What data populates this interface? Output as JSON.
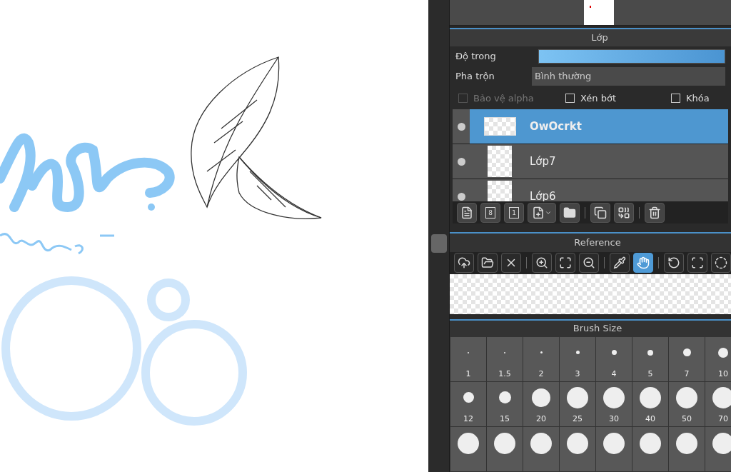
{
  "layers_panel": {
    "title": "Lớp",
    "opacity": {
      "label": "Độ trong",
      "level": 1
    },
    "blend": {
      "label": "Pha trộn",
      "value": "Bình thường"
    },
    "options": [
      {
        "label": "Bảo vệ alpha",
        "checked": false,
        "disabled": true
      },
      {
        "label": "Xén bớt",
        "checked": false,
        "disabled": false
      },
      {
        "label": "Khóa",
        "checked": false,
        "disabled": false
      }
    ],
    "layers": [
      {
        "name": "OwOcrkt",
        "selected": true,
        "visible": true
      },
      {
        "name": "Lớp7",
        "selected": false,
        "visible": true
      },
      {
        "name": "Lớp6",
        "selected": false,
        "visible": true
      }
    ],
    "tools": [
      {
        "kind": "new-page"
      },
      {
        "kind": "page-8",
        "label": "8"
      },
      {
        "kind": "page-1",
        "label": "1"
      },
      {
        "kind": "add-page"
      },
      {
        "kind": "folder"
      },
      {
        "kind": "sep"
      },
      {
        "kind": "duplicate"
      },
      {
        "kind": "merge"
      },
      {
        "kind": "sep"
      },
      {
        "kind": "trash"
      }
    ]
  },
  "reference_panel": {
    "title": "Reference",
    "tool_groups": [
      [
        {
          "kind": "upload",
          "selected": false
        },
        {
          "kind": "open-folder",
          "selected": false
        },
        {
          "kind": "close",
          "selected": false
        }
      ],
      [
        {
          "kind": "zoom-in",
          "selected": false
        },
        {
          "kind": "fit",
          "selected": false
        },
        {
          "kind": "zoom-out",
          "selected": false
        }
      ],
      [
        {
          "kind": "eyedropper",
          "selected": false
        },
        {
          "kind": "hand",
          "selected": true
        }
      ],
      [
        {
          "kind": "rotate",
          "selected": false
        },
        {
          "kind": "frame",
          "selected": false
        },
        {
          "kind": "reset",
          "selected": false
        }
      ]
    ]
  },
  "brush_size_panel": {
    "title": "Brush Size",
    "sizes": [
      {
        "label": "1"
      },
      {
        "label": "1.5"
      },
      {
        "label": "2"
      },
      {
        "label": "3"
      },
      {
        "label": "4"
      },
      {
        "label": "5"
      },
      {
        "label": "7"
      },
      {
        "label": "10"
      },
      {
        "label": "12"
      },
      {
        "label": "15"
      },
      {
        "label": "20"
      },
      {
        "label": "25"
      },
      {
        "label": "30"
      },
      {
        "label": "40"
      },
      {
        "label": "50"
      },
      {
        "label": "70"
      }
    ]
  }
}
